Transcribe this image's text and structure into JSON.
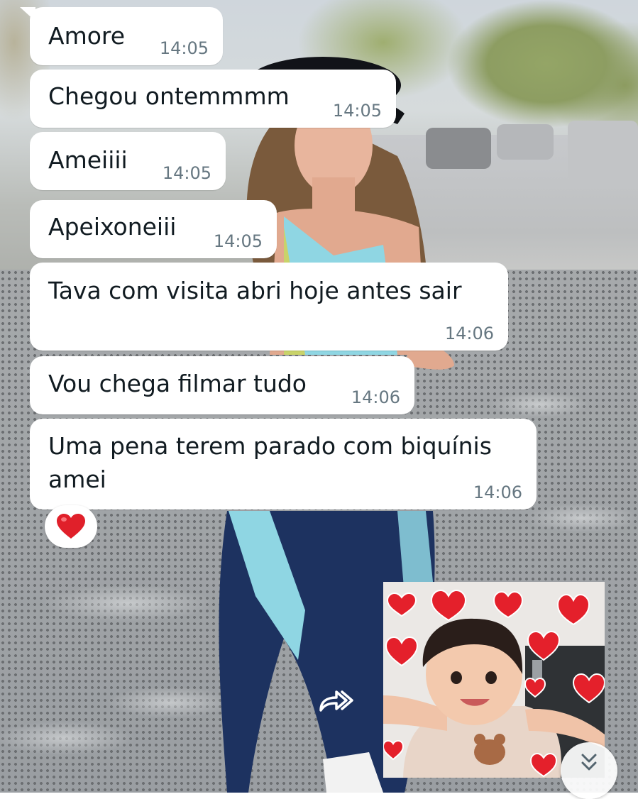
{
  "messages": [
    {
      "text": "Amore",
      "time": "14:05"
    },
    {
      "text": "Chegou ontemmmm",
      "time": "14:05"
    },
    {
      "text": "Ameiiii",
      "time": "14:05"
    },
    {
      "text": "Apeixoneiii",
      "time": "14:05"
    },
    {
      "text": "Tava com visita abri hoje antes sair",
      "time": "14:06"
    },
    {
      "text": "Vou chega filmar tudo",
      "time": "14:06"
    },
    {
      "text_line1": "Uma pena terem parado com biquínis",
      "text_line2": "amei",
      "time": "14:06"
    }
  ],
  "reaction": {
    "emoji": "red-heart-icon",
    "color": "#e0202a"
  },
  "forward_icon": "forward-arrow-icon",
  "sticker": {
    "description_icon": "child-with-hearts-sticker"
  },
  "scroll_down_icon": "double-chevron-down-icon",
  "colors": {
    "bubble": "#ffffff",
    "text": "#111b21",
    "timestamp": "#667781",
    "heart": "#e0202a"
  }
}
